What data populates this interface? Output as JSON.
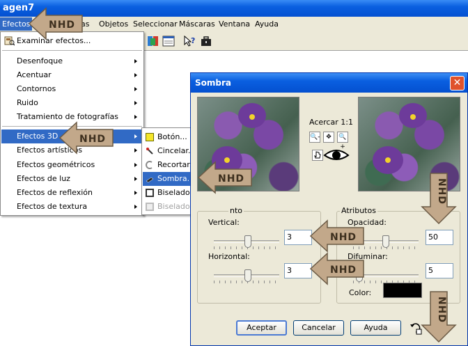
{
  "window": {
    "title": "agen7"
  },
  "menubar": {
    "items": [
      "Efectos",
      "pas",
      "Objetos",
      "Seleccionar",
      "Máscaras",
      "Ventana",
      "Ayuda"
    ]
  },
  "dropdown": {
    "items": [
      {
        "label": "Examinar efectos..."
      },
      {
        "label": "Desenfoque"
      },
      {
        "label": "Acentuar"
      },
      {
        "label": "Contornos"
      },
      {
        "label": "Ruido"
      },
      {
        "label": "Tratamiento de fotografías"
      },
      {
        "label": "Efectos 3D"
      },
      {
        "label": "Efectos artísticos"
      },
      {
        "label": "Efectos geométricos"
      },
      {
        "label": "Efectos de luz"
      },
      {
        "label": "Efectos de reflexión"
      },
      {
        "label": "Efectos de textura"
      }
    ]
  },
  "submenu": {
    "items": [
      {
        "label": "Botón..."
      },
      {
        "label": "Cincelar..."
      },
      {
        "label": "Recortar..."
      },
      {
        "label": "Sombra..."
      },
      {
        "label": "Biselado interior..."
      },
      {
        "label": "Biselado exterior..."
      }
    ]
  },
  "dialog": {
    "title": "Sombra",
    "close": "✕",
    "zoom_label": "Acercar 1:1",
    "zoom_buttons": [
      "🔍-",
      "✥",
      "🔍+"
    ],
    "group_offset": "nto",
    "vertical_label": "Vertical:",
    "vertical_value": "3",
    "horizontal_label": "Horizontal:",
    "horizontal_value": "3",
    "group_attributes": "Atributos",
    "opacity_label": "Opacidad:",
    "opacity_value": "50",
    "blur_label": "Difuminar:",
    "blur_value": "5",
    "color_label": "Color:",
    "color_value": "#000000",
    "buttons": {
      "ok": "Aceptar",
      "cancel": "Cancelar",
      "help": "Ayuda"
    }
  },
  "watermark": {
    "text": "NHD"
  },
  "colors": {
    "title_blue": "#0a5fe0",
    "selection": "#316ac5",
    "dialog_bg": "#ece9d8",
    "arrow_fill": "#c2a88a"
  }
}
